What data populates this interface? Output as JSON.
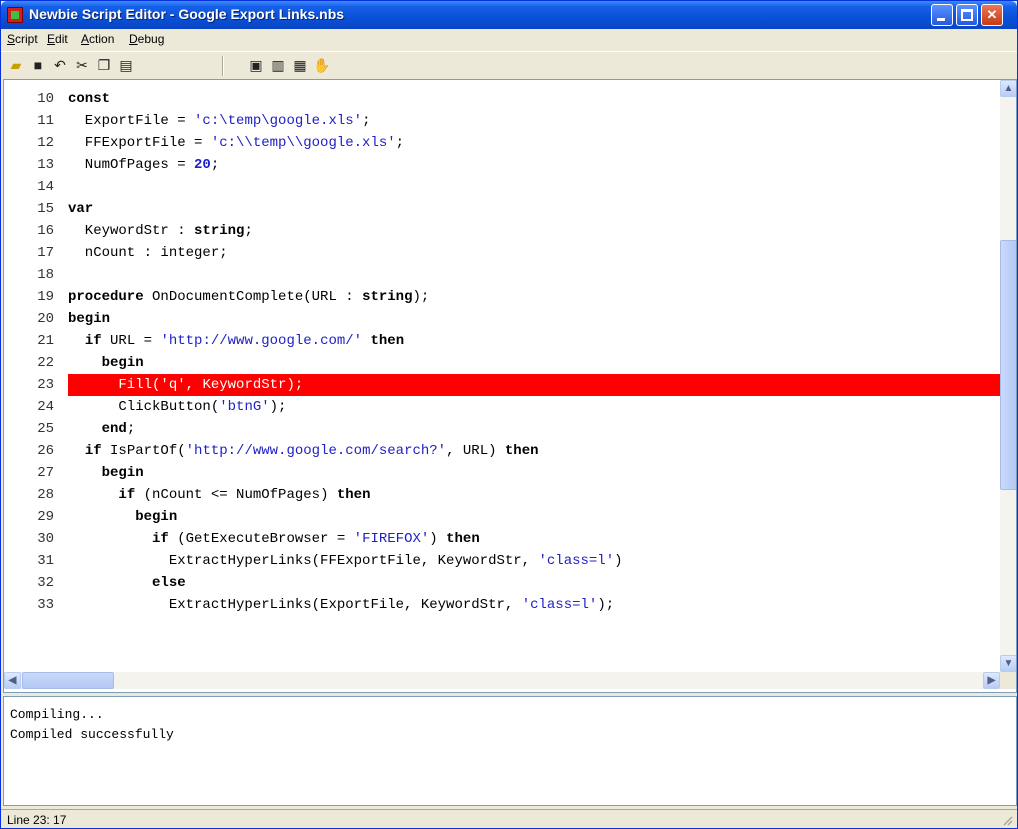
{
  "window": {
    "title": "Newbie Script Editor - Google Export Links.nbs"
  },
  "menu": [
    {
      "underline": "S",
      "rest": "cript"
    },
    {
      "underline": "E",
      "rest": "dit"
    },
    {
      "underline": "A",
      "rest": "ction"
    },
    {
      "underline": "D",
      "rest": "ebug"
    }
  ],
  "toolbar": {
    "open": "open-folder-icon",
    "save": "save-disk-icon",
    "undo": "undo-icon",
    "cut": "cut-icon",
    "copy": "copy-icon",
    "paste": "paste-icon",
    "run": "run-icon",
    "step": "step-icon",
    "compile": "compile-icon",
    "stop": "stop-hand-icon"
  },
  "editor": {
    "lines": [
      {
        "n": "10",
        "tokens": [
          [
            "kw",
            "const"
          ]
        ]
      },
      {
        "n": "11",
        "tokens": [
          [
            "t",
            "  ExportFile = "
          ],
          [
            "str",
            "'c:\\temp\\google.xls'"
          ],
          [
            "t",
            ";"
          ]
        ]
      },
      {
        "n": "12",
        "tokens": [
          [
            "t",
            "  FFExportFile = "
          ],
          [
            "str",
            "'c:\\\\temp\\\\google.xls'"
          ],
          [
            "t",
            ";"
          ]
        ]
      },
      {
        "n": "13",
        "tokens": [
          [
            "t",
            "  NumOfPages = "
          ],
          [
            "num",
            "20"
          ],
          [
            "t",
            ";"
          ]
        ]
      },
      {
        "n": "14",
        "tokens": []
      },
      {
        "n": "15",
        "tokens": [
          [
            "kw",
            "var"
          ]
        ]
      },
      {
        "n": "16",
        "tokens": [
          [
            "t",
            "  KeywordStr : "
          ],
          [
            "kw",
            "string"
          ],
          [
            "t",
            ";"
          ]
        ]
      },
      {
        "n": "17",
        "tokens": [
          [
            "t",
            "  nCount : integer;"
          ]
        ]
      },
      {
        "n": "18",
        "tokens": []
      },
      {
        "n": "19",
        "tokens": [
          [
            "kw",
            "procedure"
          ],
          [
            "t",
            " OnDocumentComplete(URL : "
          ],
          [
            "kw",
            "string"
          ],
          [
            "t",
            ");"
          ]
        ]
      },
      {
        "n": "20",
        "tokens": [
          [
            "kw",
            "begin"
          ]
        ]
      },
      {
        "n": "21",
        "tokens": [
          [
            "t",
            "  "
          ],
          [
            "kw",
            "if"
          ],
          [
            "t",
            " URL = "
          ],
          [
            "str",
            "'http://www.google.com/'"
          ],
          [
            "t",
            " "
          ],
          [
            "kw",
            "then"
          ]
        ]
      },
      {
        "n": "22",
        "tokens": [
          [
            "t",
            "    "
          ],
          [
            "kw",
            "begin"
          ]
        ]
      },
      {
        "n": "23",
        "tokens": [
          [
            "t",
            "      Fill("
          ],
          [
            "str",
            "'q'"
          ],
          [
            "t",
            ", KeywordStr);"
          ]
        ],
        "error": true
      },
      {
        "n": "24",
        "tokens": [
          [
            "t",
            "      ClickButton("
          ],
          [
            "str",
            "'btnG'"
          ],
          [
            "t",
            ");"
          ]
        ]
      },
      {
        "n": "25",
        "tokens": [
          [
            "t",
            "    "
          ],
          [
            "kw",
            "end"
          ],
          [
            "t",
            ";"
          ]
        ]
      },
      {
        "n": "26",
        "tokens": [
          [
            "t",
            "  "
          ],
          [
            "kw",
            "if"
          ],
          [
            "t",
            " IsPartOf("
          ],
          [
            "str",
            "'http://www.google.com/search?'"
          ],
          [
            "t",
            ", URL) "
          ],
          [
            "kw",
            "then"
          ]
        ]
      },
      {
        "n": "27",
        "tokens": [
          [
            "t",
            "    "
          ],
          [
            "kw",
            "begin"
          ]
        ]
      },
      {
        "n": "28",
        "tokens": [
          [
            "t",
            "      "
          ],
          [
            "kw",
            "if"
          ],
          [
            "t",
            " (nCount <= NumOfPages) "
          ],
          [
            "kw",
            "then"
          ]
        ]
      },
      {
        "n": "29",
        "tokens": [
          [
            "t",
            "        "
          ],
          [
            "kw",
            "begin"
          ]
        ]
      },
      {
        "n": "30",
        "tokens": [
          [
            "t",
            "          "
          ],
          [
            "kw",
            "if"
          ],
          [
            "t",
            " (GetExecuteBrowser = "
          ],
          [
            "str",
            "'FIREFOX'"
          ],
          [
            "t",
            ") "
          ],
          [
            "kw",
            "then"
          ]
        ]
      },
      {
        "n": "31",
        "tokens": [
          [
            "t",
            "            ExtractHyperLinks(FFExportFile, KeywordStr, "
          ],
          [
            "str",
            "'class=l'"
          ],
          [
            "t",
            ")"
          ]
        ]
      },
      {
        "n": "32",
        "tokens": [
          [
            "t",
            "          "
          ],
          [
            "kw",
            "else"
          ]
        ]
      },
      {
        "n": "33",
        "tokens": [
          [
            "t",
            "            ExtractHyperLinks(ExportFile, KeywordStr, "
          ],
          [
            "str",
            "'class=l'"
          ],
          [
            "t",
            ");"
          ]
        ]
      }
    ]
  },
  "output": {
    "lines": [
      "Compiling...",
      "Compiled successfully"
    ]
  },
  "status": {
    "text": "Line 23: 17"
  },
  "colors": {
    "error_line": "#ff0000",
    "string": "#2020c8",
    "titlebar": "#0a50d8"
  }
}
